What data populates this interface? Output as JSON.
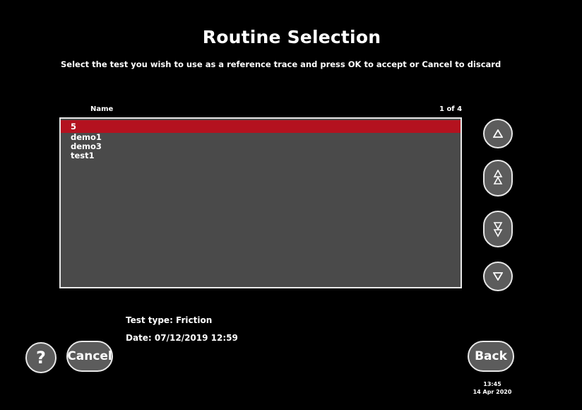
{
  "title": "Routine Selection",
  "instruction": "Select the test you wish to use as a reference trace and press OK to accept or Cancel to discard",
  "list": {
    "column_name": "Name",
    "page_indicator": "1 of 4",
    "items": [
      "5",
      "demo1",
      "demo3",
      "test1"
    ],
    "selected_index": 0
  },
  "details": {
    "test_type": "Test type: Friction",
    "date": "Date: 07/12/2019 12:59"
  },
  "buttons": {
    "help": "?",
    "cancel": "Cancel",
    "back": "Back",
    "scroll_up": "up-arrow-icon",
    "page_up": "double-up-arrow-icon",
    "page_down": "double-down-arrow-icon",
    "scroll_down": "down-arrow-icon"
  },
  "clock": {
    "time": "13:45",
    "date": "14 Apr 2020"
  },
  "colors": {
    "background": "#000000",
    "list_background": "#4a4a4a",
    "selection": "#b4121f",
    "button": "#5c5c5c",
    "border": "#e8e8e8"
  }
}
